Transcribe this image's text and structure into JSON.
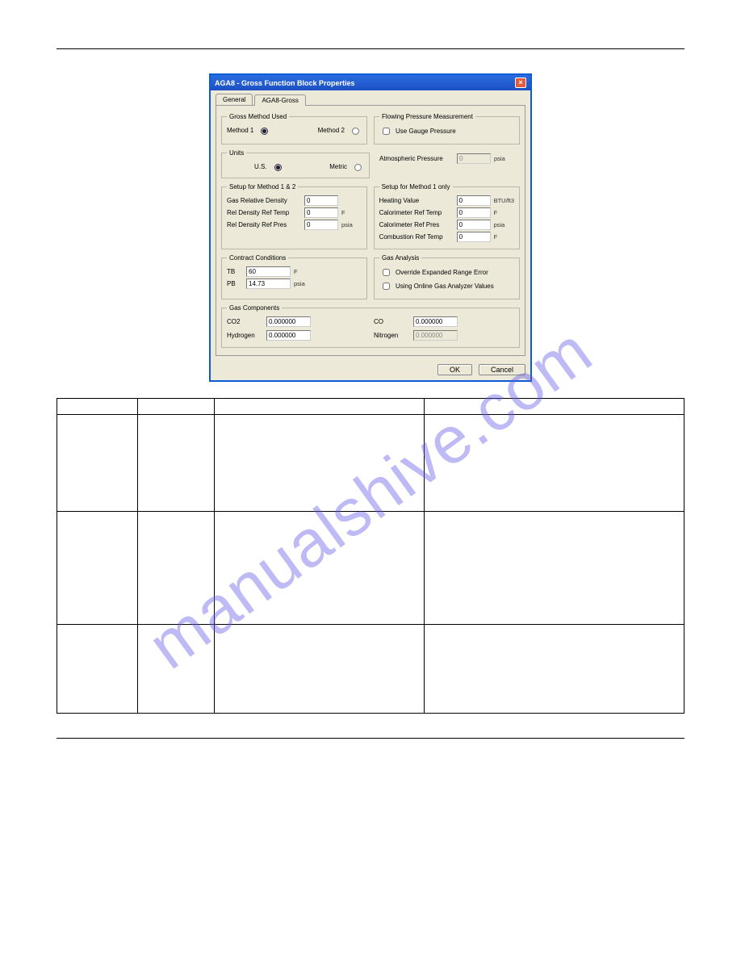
{
  "watermark": "manualshive.com",
  "dialog": {
    "title": "AGA8 - Gross Function Block Properties",
    "tabs": {
      "general": "General",
      "gross": "AGA8-Gross"
    },
    "groups": {
      "method": {
        "legend": "Gross Method Used",
        "m1": "Method 1",
        "m2": "Method 2"
      },
      "pressure": {
        "legend": "Flowing Pressure Measurement",
        "gauge": "Use Gauge Pressure",
        "atm_label": "Atmospheric Pressure",
        "atm_value": "0",
        "atm_unit": "psia"
      },
      "units": {
        "legend": "Units",
        "us": "U.S.",
        "metric": "Metric"
      },
      "setup12": {
        "legend": "Setup for Method 1 & 2",
        "grd_label": "Gas Relative Density",
        "grd_value": "0",
        "rt_label": "Rel Density Ref Temp",
        "rt_value": "0",
        "rt_unit": "F",
        "rp_label": "Rel Density Ref Pres",
        "rp_value": "0",
        "rp_unit": "psia"
      },
      "setup1": {
        "legend": "Setup for Method 1 only",
        "hv_label": "Heating Value",
        "hv_value": "0",
        "hv_unit": "BTU/ft3",
        "crt_label": "Calorimeter Ref Temp",
        "crt_value": "0",
        "crt_unit": "F",
        "crp_label": "Calorimeter Ref Pres",
        "crp_value": "0",
        "crp_unit": "psia",
        "crbt_label": "Combustion Ref Temp",
        "crbt_value": "0",
        "crbt_unit": "F"
      },
      "contract": {
        "legend": "Contract Conditions",
        "tb_label": "TB",
        "tb_value": "60",
        "tb_unit": "F",
        "pb_label": "PB",
        "pb_value": "14.73",
        "pb_unit": "psia"
      },
      "analysis": {
        "legend": "Gas Analysis",
        "override": "Override Expanded Range Error",
        "online": "Using Online Gas Analyzer Values"
      },
      "components": {
        "legend": "Gas Components",
        "co2_label": "CO2",
        "co2_value": "0.000000",
        "co_label": "CO",
        "co_value": "0.000000",
        "h2_label": "Hydrogen",
        "h2_value": "0.000000",
        "n2_label": "Nitrogen",
        "n2_value": "0.000000"
      }
    },
    "buttons": {
      "ok": "OK",
      "cancel": "Cancel"
    }
  },
  "table": {
    "headers": [
      "",
      "",
      "",
      ""
    ],
    "rows": [
      [
        "",
        "",
        "",
        ""
      ],
      [
        "",
        "",
        "",
        ""
      ],
      [
        "",
        "",
        "",
        ""
      ]
    ]
  }
}
